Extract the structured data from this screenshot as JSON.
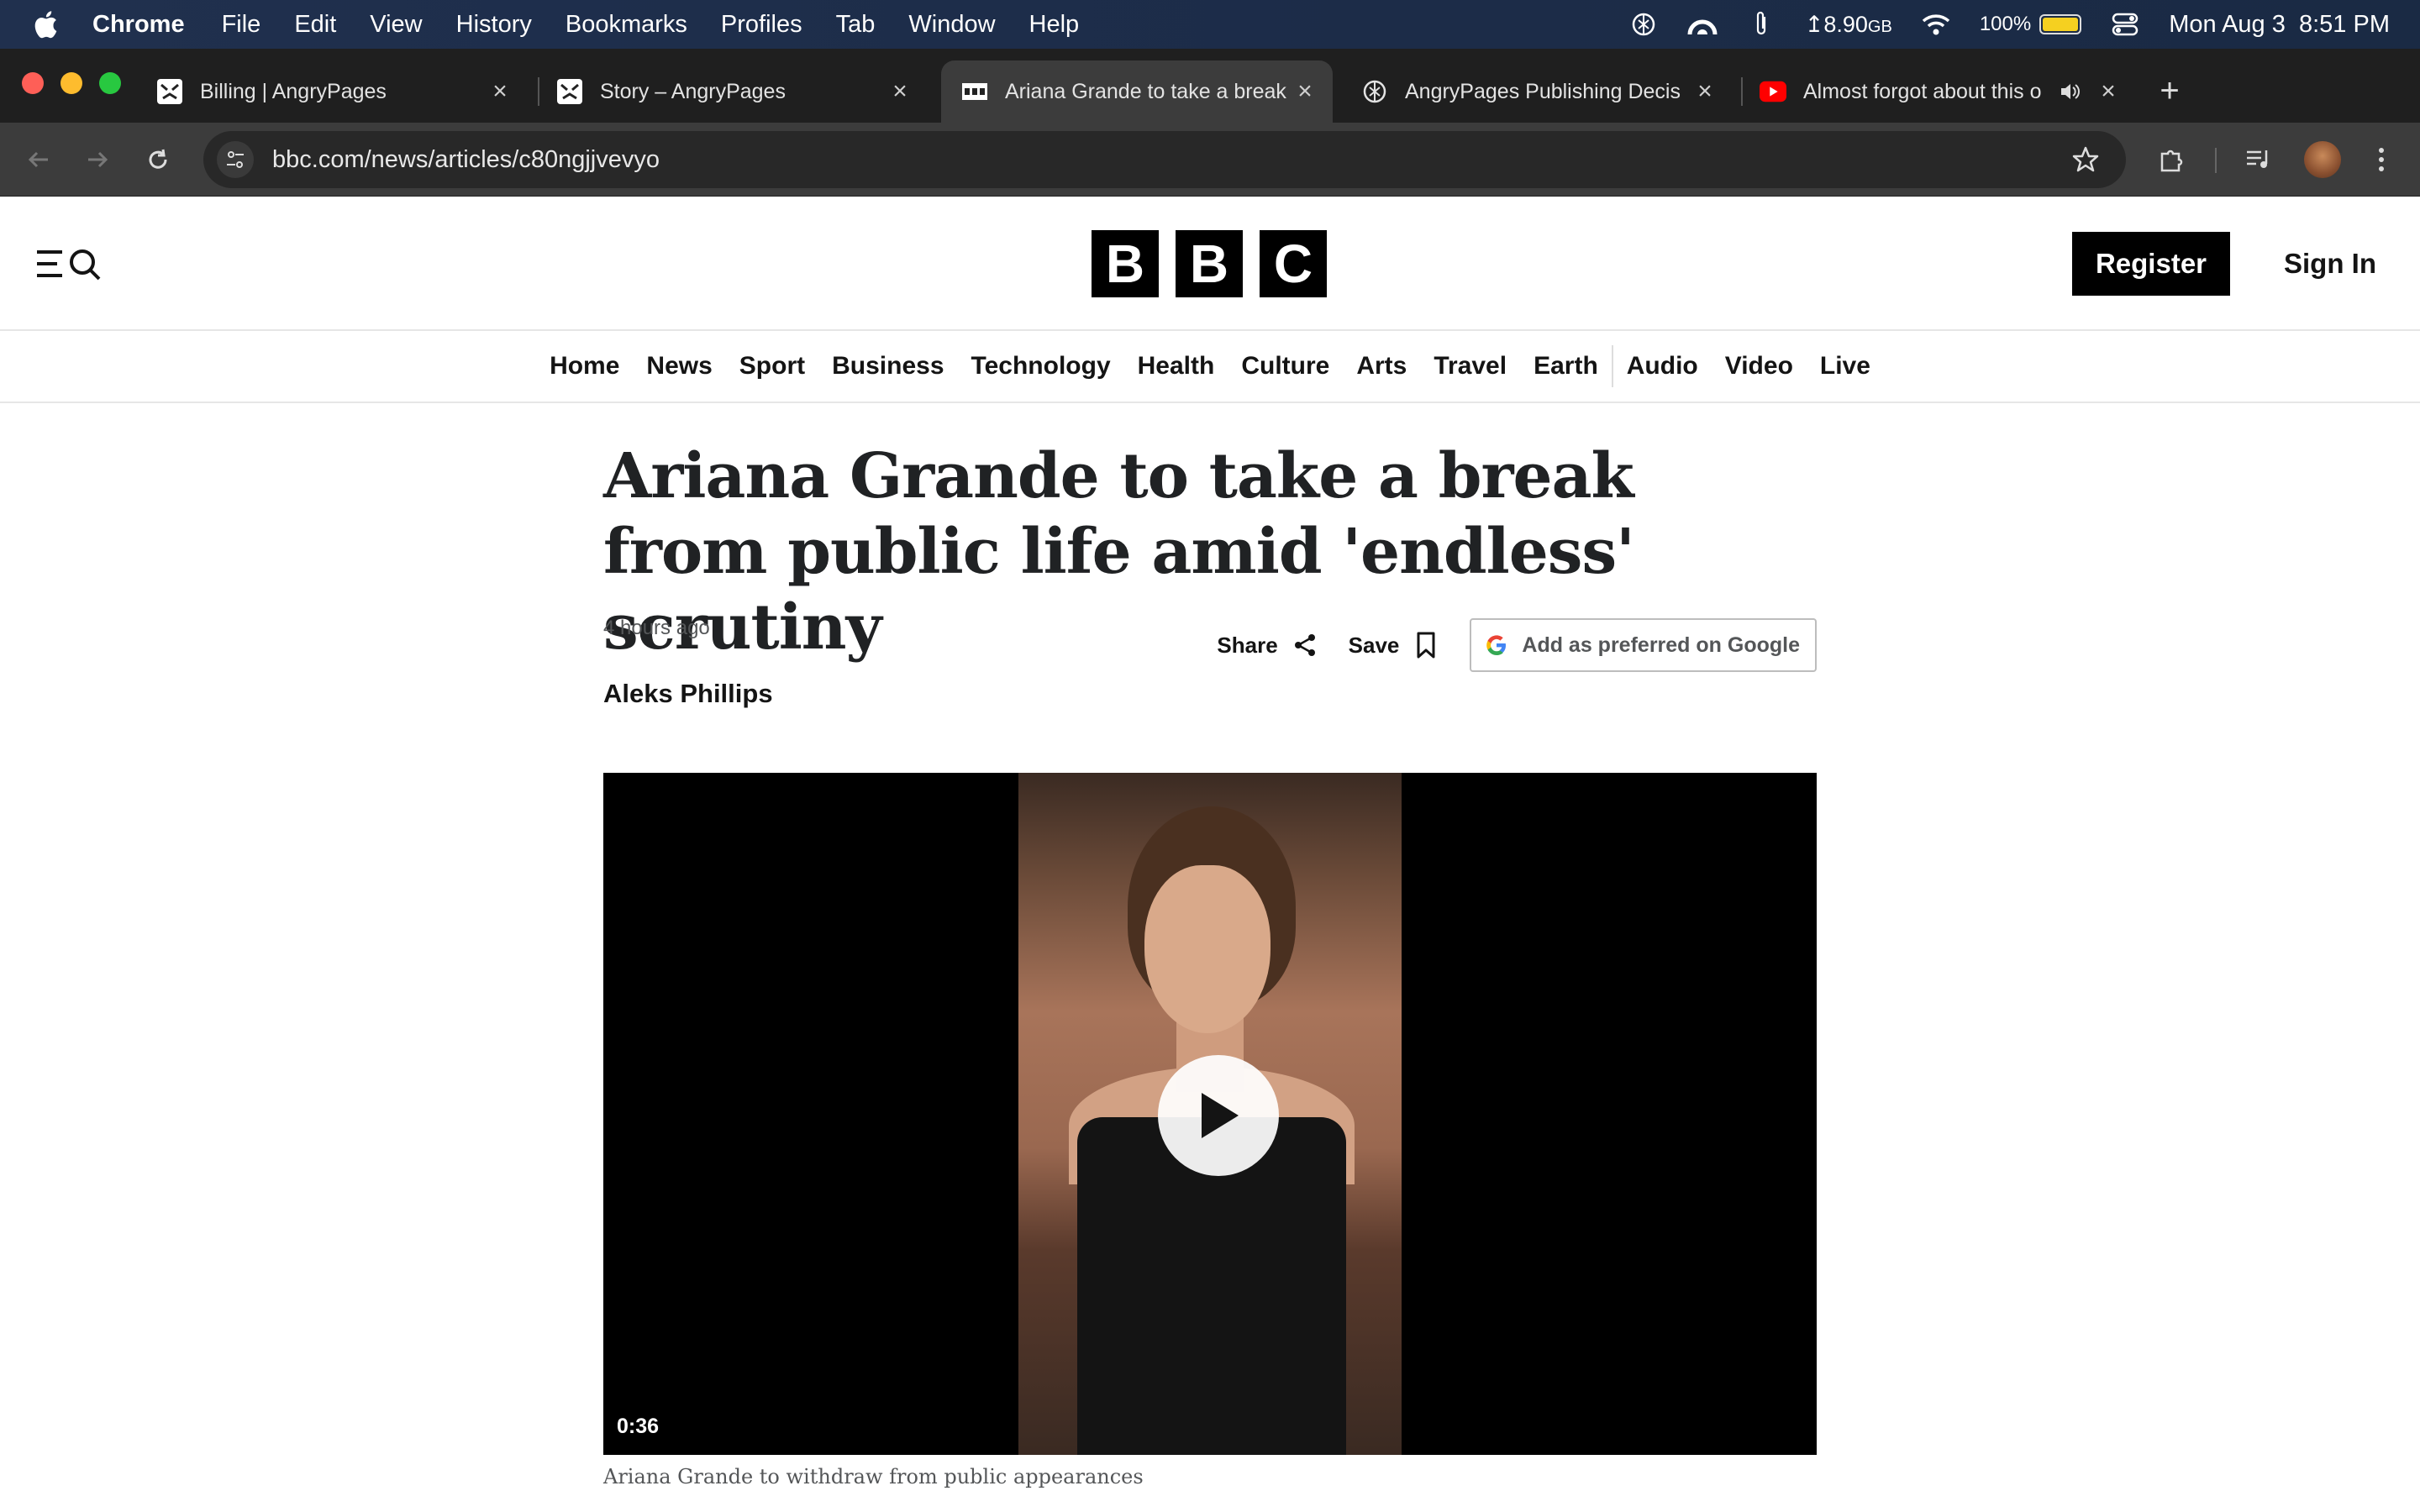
{
  "menubar": {
    "app": "Chrome",
    "items": [
      "File",
      "Edit",
      "View",
      "History",
      "Bookmarks",
      "Profiles",
      "Tab",
      "Window",
      "Help"
    ],
    "storage": "↥8.90",
    "storage_unit": "GB",
    "battery": "100%",
    "battery_level": 1.0,
    "datetime": "Mon Aug 3  8:51 PM"
  },
  "tabs": [
    {
      "title": "Billing | AngryPages",
      "icon": "angrypages-icon"
    },
    {
      "title": "Story – AngryPages",
      "icon": "angrypages-icon"
    },
    {
      "title": "Ariana Grande to take a break",
      "icon": "bbc-icon"
    },
    {
      "title": "AngryPages Publishing Decis",
      "icon": "openai-icon"
    },
    {
      "title": "Almost forgot about this o",
      "icon": "youtube-icon"
    }
  ],
  "toolbar": {
    "url": "bbc.com/news/articles/c80ngjjvevyo"
  },
  "bbc": {
    "logo": [
      "B",
      "B",
      "C"
    ],
    "register": "Register",
    "sign_in": "Sign In",
    "nav": [
      "Home",
      "News",
      "Sport",
      "Business",
      "Technology",
      "Health",
      "Culture",
      "Arts",
      "Travel",
      "Earth",
      "Audio",
      "Video",
      "Live"
    ]
  },
  "article": {
    "headline": "Ariana Grande to take a break from public life amid 'endless' scrutiny",
    "timestamp": "4 hours ago",
    "byline": "Aleks Phillips",
    "share": "Share",
    "save": "Save",
    "google": "Add as preferred on Google",
    "video_duration": "0:36",
    "caption": "Ariana Grande to withdraw from public appearances"
  },
  "colors": {
    "menubar": "#1d2d4a",
    "tabstrip": "#1f1f1f",
    "toolbar": "#3c3c3c",
    "youtube": "#ff0000",
    "bbc_black": "#000000"
  }
}
